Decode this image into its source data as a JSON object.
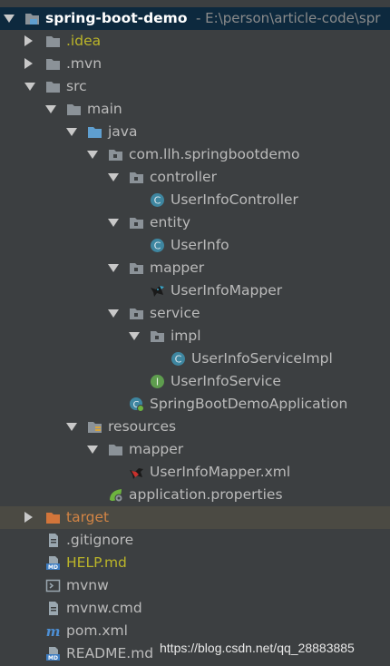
{
  "tree": {
    "root": {
      "name": "spring-boot-demo",
      "path": "- E:\\person\\article-code\\spr"
    },
    "items": [
      {
        "label": ".idea"
      },
      {
        "label": ".mvn"
      },
      {
        "label": "src"
      },
      {
        "label": "main"
      },
      {
        "label": "java"
      },
      {
        "label": "com.llh.springbootdemo"
      },
      {
        "label": "controller"
      },
      {
        "label": "UserInfoController"
      },
      {
        "label": "entity"
      },
      {
        "label": "UserInfo"
      },
      {
        "label": "mapper"
      },
      {
        "label": "UserInfoMapper"
      },
      {
        "label": "service"
      },
      {
        "label": "impl"
      },
      {
        "label": "UserInfoServiceImpl"
      },
      {
        "label": "UserInfoService"
      },
      {
        "label": "SpringBootDemoApplication"
      },
      {
        "label": "resources"
      },
      {
        "label": "mapper"
      },
      {
        "label": "UserInfoMapper.xml"
      },
      {
        "label": "application.properties"
      },
      {
        "label": "target"
      },
      {
        "label": ".gitignore"
      },
      {
        "label": "HELP.md"
      },
      {
        "label": "mvnw"
      },
      {
        "label": "mvnw.cmd"
      },
      {
        "label": "pom.xml"
      },
      {
        "label": "README.md"
      }
    ]
  },
  "watermark": "https://blog.csdn.net/qq_28883885",
  "colors": {
    "background": "#3c3f41",
    "selected_row": "#0d293e",
    "highlight_row": "#4b4a43",
    "folder": "#8b9298",
    "source_folder": "#5f9fd0",
    "class_icon": "#3e86a0",
    "interface_icon": "#5e9d4e",
    "excluded_folder": "#d2753a",
    "ignored_text": "#bbb529",
    "excluded_text": "#d28445"
  },
  "icons": {
    "root": "module-folder-icon",
    "folder": "folder-icon",
    "package": "package-icon",
    "class": "class-icon",
    "interface": "interface-icon",
    "mybatis": "mybatis-bird-icon",
    "spring": "spring-boot-class-icon",
    "resources": "resources-folder-icon",
    "xml": "xml-file-icon",
    "properties": "spring-properties-icon",
    "excluded": "excluded-folder-icon",
    "text": "text-file-icon",
    "markdown": "markdown-file-icon",
    "script": "script-file-icon",
    "maven": "maven-file-icon"
  }
}
